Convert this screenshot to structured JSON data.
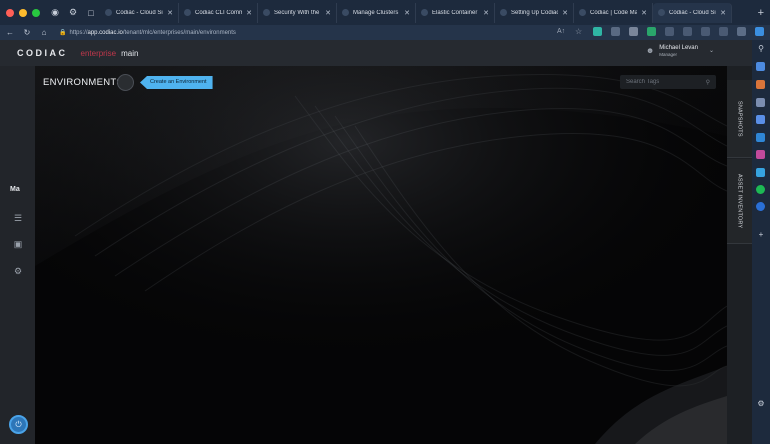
{
  "browser": {
    "tabs": [
      {
        "label": "Codiac - Cloud Simp",
        "active": false
      },
      {
        "label": "Codiac CLI Comman",
        "active": false
      },
      {
        "label": "Security With the Cli",
        "active": false
      },
      {
        "label": "Manage Clusters | C",
        "active": false
      },
      {
        "label": "Elastic Container Re",
        "active": false
      },
      {
        "label": "Setting Up Codiac f",
        "active": false
      },
      {
        "label": "Codiac | Code Mana",
        "active": false
      },
      {
        "label": "Codiac - Cloud Simp",
        "active": true
      }
    ],
    "url_scheme": "https://",
    "url_host": "app.codiac.io",
    "url_path": "/tenant/mlc/enterprises/main/environments",
    "colors": {
      "tabbar": "#1d2a3d",
      "toolbar": "#25344a"
    }
  },
  "app": {
    "logo": "CODIAC",
    "enterprise_label": "enterprise",
    "enterprise_name": "main",
    "user_name": "Michael Levan",
    "user_role": "Manager",
    "accent": "#4fb3ef",
    "brand_red": "#c0374b"
  },
  "main": {
    "title": "ENVIRONMENTS",
    "create_button": "Create an Environment",
    "search_placeholder": "Search Tags"
  },
  "rail": {
    "workspace_abbrev": "Ma",
    "icons": [
      "sliders-icon",
      "calendar-icon",
      "gear-icon",
      "power-icon"
    ]
  },
  "drawer": {
    "tabs": [
      "SNAPSHOTS",
      "ASSET INVENTORY"
    ]
  }
}
